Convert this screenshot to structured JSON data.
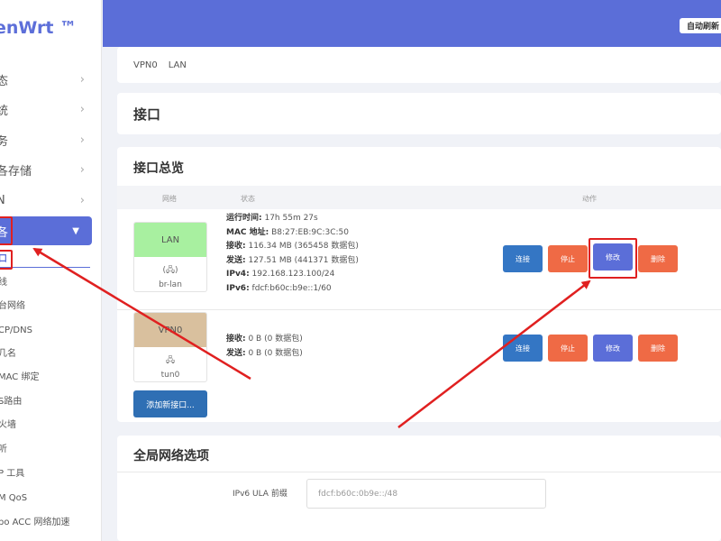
{
  "brand": "enWrt ™",
  "sidebar": {
    "items": [
      {
        "label": "态"
      },
      {
        "label": "统"
      },
      {
        "label": "务"
      },
      {
        "label": "各存储"
      },
      {
        "label": "N"
      }
    ],
    "active": {
      "label": "各"
    },
    "sub_items": [
      {
        "label": "口"
      },
      {
        "label": "线"
      },
      {
        "label": "台网络"
      },
      {
        "label": "CP/DNS"
      },
      {
        "label": "几名"
      },
      {
        "label": "MAC 绑定"
      },
      {
        "label": "S路由"
      },
      {
        "label": "火墙"
      },
      {
        "label": "听"
      },
      {
        "label": "P 工具"
      },
      {
        "label": "M QoS"
      },
      {
        "label": "bo ACC 网络加速"
      }
    ]
  },
  "header": {
    "auto_refresh": "自动刷新"
  },
  "breadcrumb": [
    "VPN0",
    "LAN"
  ],
  "page_title": "接口",
  "overview": {
    "title": "接口总览",
    "columns": {
      "network": "网络",
      "status": "状态",
      "actions": "动作"
    },
    "interfaces": [
      {
        "name": "LAN",
        "color": "#a8f0a0",
        "icon_text": "(🖧)",
        "device": "br-lan",
        "stats": [
          {
            "k": "运行时间:",
            "v": " 17h 55m 27s"
          },
          {
            "k": "MAC 地址:",
            "v": " B8:27:EB:9C:3C:50"
          },
          {
            "k": "接收:",
            "v": " 116.34 MB (365458 数据包)"
          },
          {
            "k": "发送:",
            "v": " 127.51 MB (441371 数据包)"
          },
          {
            "k": "IPv4:",
            "v": " 192.168.123.100/24"
          },
          {
            "k": "IPv6:",
            "v": " fdcf:b60c:b9e::1/60"
          }
        ]
      },
      {
        "name": "VPN0",
        "color": "#d9c09e",
        "icon_text": "🖧",
        "device": "tun0",
        "stats": [
          {
            "k": "接收:",
            "v": " 0 B (0 数据包)"
          },
          {
            "k": "发送:",
            "v": " 0 B (0 数据包)"
          }
        ]
      }
    ],
    "buttons": {
      "connect": "连接",
      "stop": "停止",
      "edit": "修改",
      "delete": "删除"
    },
    "add_button": "添加新接口..."
  },
  "global": {
    "title": "全局网络选项",
    "ula_label": "IPv6 ULA 前缀",
    "ula_value": "fdcf:b60c:0b9e::/48"
  }
}
